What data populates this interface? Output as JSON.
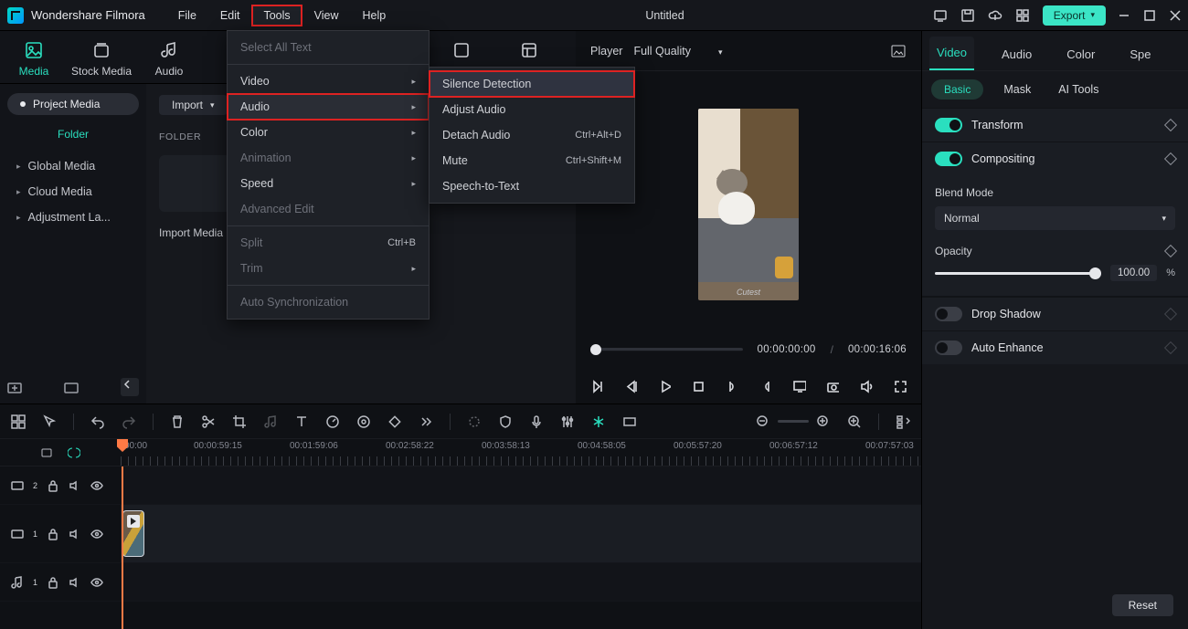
{
  "app_name": "Wondershare Filmora",
  "doc_title": "Untitled",
  "menubar": [
    "File",
    "Edit",
    "Tools",
    "View",
    "Help"
  ],
  "menubar_open_index": 2,
  "export_label": "Export",
  "media_tabs": [
    "Media",
    "Stock Media",
    "Audio",
    "Stickers",
    "Templates"
  ],
  "media_tabs_partial": [
    "ckers",
    "Templates"
  ],
  "sidebar": {
    "chip": "Project Media",
    "folder_label": "Folder",
    "items": [
      "Global Media",
      "Cloud Media",
      "Adjustment La..."
    ]
  },
  "import": {
    "drop_label": "Import",
    "folder_label": "FOLDER",
    "caption": "Import Media"
  },
  "tools_menu": {
    "items": [
      {
        "label": "Select All Text",
        "dim": true
      },
      {
        "sep": true
      },
      {
        "label": "Video",
        "submenu": true
      },
      {
        "label": "Audio",
        "submenu": true,
        "hl": true
      },
      {
        "label": "Color",
        "submenu": true
      },
      {
        "label": "Animation",
        "submenu": true,
        "dim": true
      },
      {
        "label": "Speed",
        "submenu": true
      },
      {
        "label": "Advanced Edit",
        "dim": true
      },
      {
        "sep": true
      },
      {
        "label": "Split",
        "shortcut": "Ctrl+B",
        "dim": true
      },
      {
        "label": "Trim",
        "submenu": true,
        "dim": true
      },
      {
        "sep": true
      },
      {
        "label": "Auto Synchronization",
        "dim": true
      }
    ]
  },
  "audio_submenu": [
    {
      "label": "Silence Detection",
      "hl": true
    },
    {
      "label": "Adjust Audio"
    },
    {
      "label": "Detach Audio",
      "shortcut": "Ctrl+Alt+D"
    },
    {
      "label": "Mute",
      "shortcut": "Ctrl+Shift+M"
    },
    {
      "label": "Speech-to-Text"
    }
  ],
  "preview": {
    "player_label": "Player",
    "quality": "Full Quality",
    "frame_caption": "Cutest",
    "time_current": "00:00:00:00",
    "time_total": "00:00:16:06"
  },
  "props": {
    "tabs": [
      "Video",
      "Audio",
      "Color",
      "Spe"
    ],
    "subtabs": [
      "Basic",
      "Mask",
      "AI Tools"
    ],
    "transform": "Transform",
    "compositing": "Compositing",
    "blend_mode_label": "Blend Mode",
    "blend_mode_value": "Normal",
    "opacity_label": "Opacity",
    "opacity_value": "100.00",
    "opacity_unit": "%",
    "drop_shadow": "Drop Shadow",
    "auto_enhance": "Auto Enhance",
    "reset": "Reset"
  },
  "timeline": {
    "ruler_start": "00:00",
    "ticks": [
      "00:00:59:15",
      "00:01:59:06",
      "00:02:58:22",
      "00:03:58:13",
      "00:04:58:05",
      "00:05:57:20",
      "00:06:57:12",
      "00:07:57:03"
    ],
    "tracks": [
      {
        "type": "video",
        "index": "2"
      },
      {
        "type": "video",
        "index": "1",
        "big": true,
        "has_clip": true
      },
      {
        "type": "audio",
        "index": "1"
      }
    ]
  }
}
